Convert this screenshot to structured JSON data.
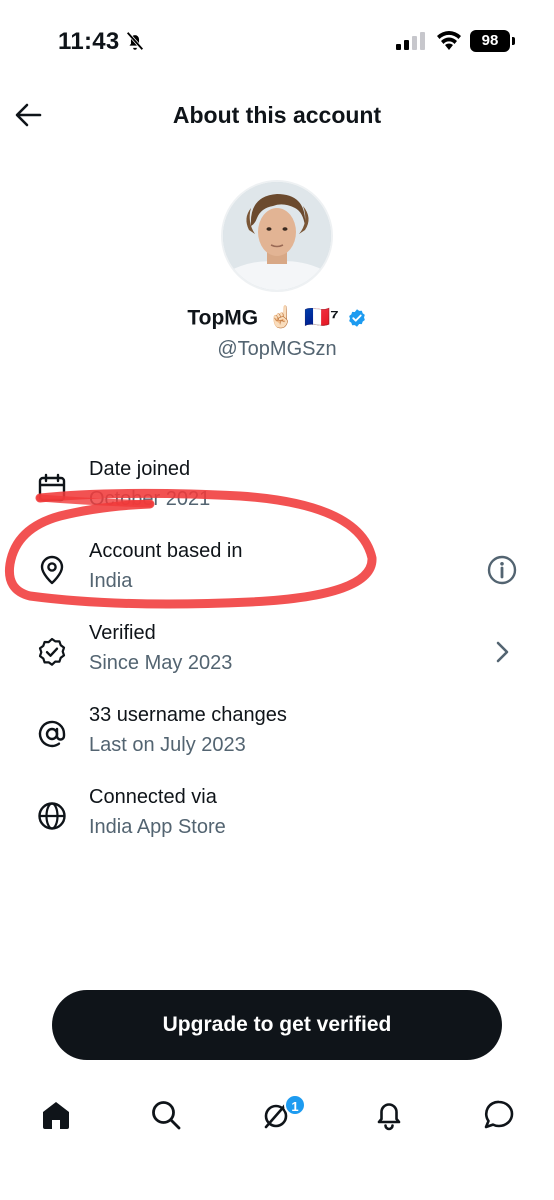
{
  "status_bar": {
    "time": "11:43",
    "battery": "98",
    "icons": [
      "bell-off-icon",
      "signal-icon",
      "wifi-icon",
      "battery-icon"
    ]
  },
  "header": {
    "title": "About this account",
    "back_icon": "arrow-left-icon"
  },
  "profile": {
    "name": "TopMG",
    "emojis": [
      "☝🏻",
      "🇫🇷⁷"
    ],
    "verified_color": "#1d9bf0",
    "handle": "@TopMGSzn"
  },
  "rows": [
    {
      "icon": "calendar-icon",
      "title": "Date joined",
      "subtitle": "October 2021"
    },
    {
      "icon": "location-pin-icon",
      "title": "Account based in",
      "subtitle": "India",
      "action_icon": "info-icon"
    },
    {
      "icon": "verified-check-icon",
      "title": "Verified",
      "subtitle": "Since May 2023",
      "action_icon": "chevron-right-icon"
    },
    {
      "icon": "at-sign-icon",
      "title": "33 username changes",
      "subtitle": "Last on July 2023"
    },
    {
      "icon": "globe-icon",
      "title": "Connected via",
      "subtitle": "India App Store"
    }
  ],
  "annotation_color": "#f03a3a",
  "upgrade_button": {
    "label": "Upgrade to get verified"
  },
  "tab_bar": {
    "tabs": [
      "home-icon",
      "search-icon",
      "grok-icon",
      "notifications-icon",
      "messages-icon"
    ],
    "badge": "1"
  }
}
